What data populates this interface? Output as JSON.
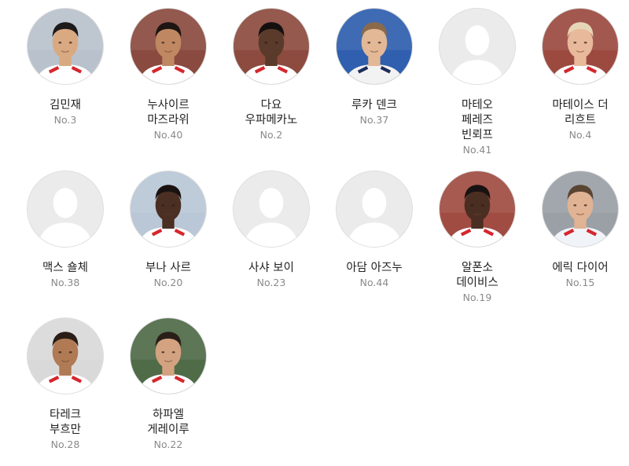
{
  "players": [
    {
      "name": "김민재",
      "number": "No.3",
      "photo": "photo",
      "bg": "#b9c2cc",
      "skin": "#d9a982",
      "hair": "#1c1a1a",
      "shirt": "#ffffff",
      "trim": "#d6262d"
    },
    {
      "name": "누사이르\n마즈라위",
      "number": "No.40",
      "photo": "photo",
      "bg": "#8a4a3f",
      "skin": "#c08862",
      "hair": "#1d1512",
      "shirt": "#ffffff",
      "trim": "#d6262d"
    },
    {
      "name": "다요\n우파메카노",
      "number": "No.2",
      "photo": "photo",
      "bg": "#8c4b3e",
      "skin": "#5a3a2a",
      "hair": "#151010",
      "shirt": "#ffffff",
      "trim": "#d6262d"
    },
    {
      "name": "루카 덴크",
      "number": "No.37",
      "photo": "photo",
      "bg": "#2f5fae",
      "skin": "#e3b896",
      "hair": "#8a6a4a",
      "shirt": "#f2f2f2",
      "trim": "#1d2d5a"
    },
    {
      "name": "마테오\n페레즈\n빈뢰프",
      "number": "No.41",
      "photo": "placeholder"
    },
    {
      "name": "마테이스 더\n리흐트",
      "number": "No.4",
      "photo": "photo",
      "bg": "#9c4a40",
      "skin": "#e8b99a",
      "hair": "#e6d6b8",
      "shirt": "#ffffff",
      "trim": "#d6262d"
    },
    {
      "name": "맥스 숄체",
      "number": "No.38",
      "photo": "placeholder"
    },
    {
      "name": "부나 사르",
      "number": "No.20",
      "photo": "photo",
      "bg": "#b9c7d6",
      "skin": "#4a2f22",
      "hair": "#1a1210",
      "shirt": "#ffffff",
      "trim": "#d6262d"
    },
    {
      "name": "사샤 보이",
      "number": "No.23",
      "photo": "placeholder"
    },
    {
      "name": "아담 아즈누",
      "number": "No.44",
      "photo": "placeholder"
    },
    {
      "name": "알폰소\n데이비스",
      "number": "No.19",
      "photo": "photo",
      "bg": "#a04c42",
      "skin": "#4b2e22",
      "hair": "#191212",
      "shirt": "#ffffff",
      "trim": "#d6262d"
    },
    {
      "name": "에릭 다이어",
      "number": "No.15",
      "photo": "photo",
      "bg": "#9aa0a6",
      "skin": "#e0b394",
      "hair": "#5a4532",
      "shirt": "#f0f3f7",
      "trim": "#d6262d"
    },
    {
      "name": "타레크\n부흐만",
      "number": "No.28",
      "photo": "photo",
      "bg": "#d9d9d9",
      "skin": "#b07a55",
      "hair": "#2a1d15",
      "shirt": "#ffffff",
      "trim": "#d6262d"
    },
    {
      "name": "하파엘\n게레이루",
      "number": "No.22",
      "photo": "photo",
      "bg": "#4f6b48",
      "skin": "#d3a281",
      "hair": "#2a1f18",
      "shirt": "#ffffff",
      "trim": "#d6262d"
    }
  ]
}
